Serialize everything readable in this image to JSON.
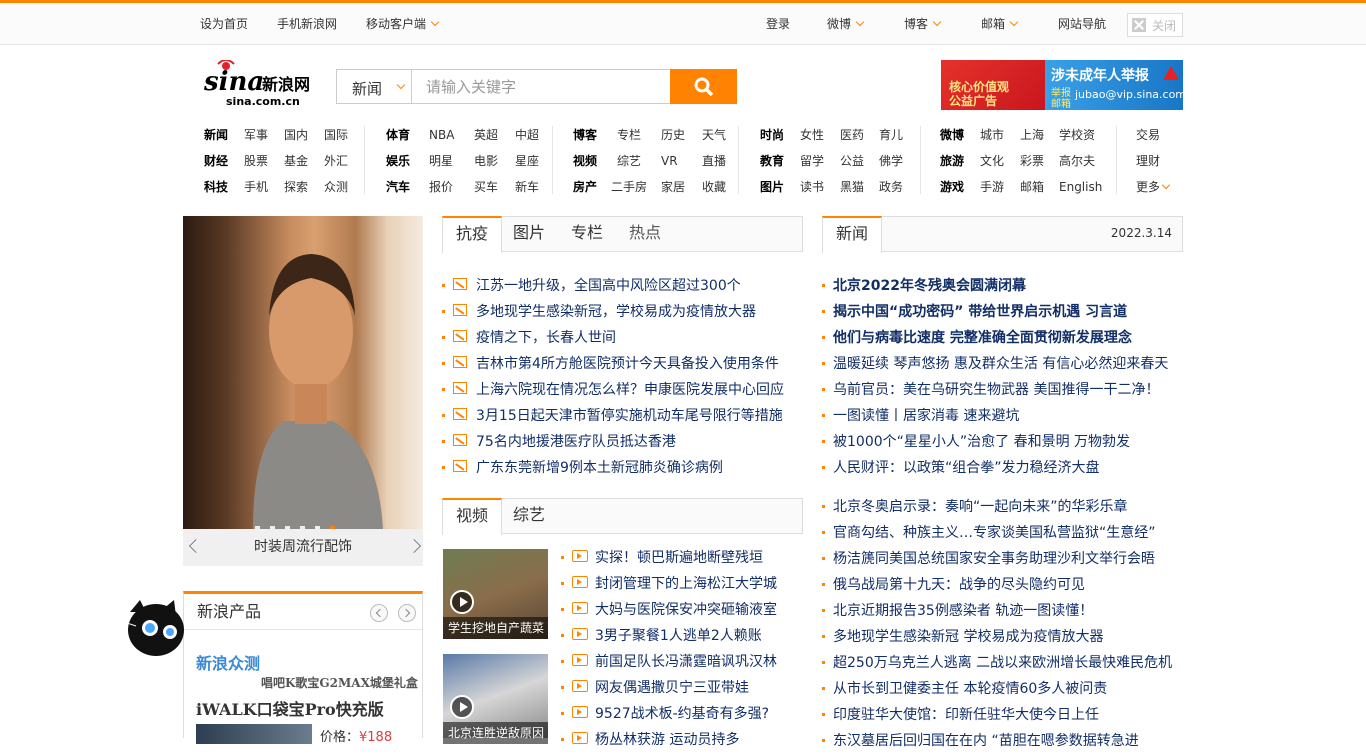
{
  "topbar": {
    "left": [
      "设为首页",
      "手机新浪网",
      "移动客户端"
    ],
    "right": [
      "登录",
      "微博",
      "博客",
      "邮箱",
      "网站导航"
    ],
    "close_label": "关闭"
  },
  "logo": {
    "brand": "sina新浪网",
    "domain": "sina.com.cn"
  },
  "search": {
    "category": "新闻",
    "placeholder": "请输入关键字"
  },
  "ad": {
    "left_text_1": "核心价值观",
    "left_text_2": "公益广告",
    "title": "涉未成年人举报",
    "sub_label": "举报邮箱",
    "email": "jubao@vip.sina.com"
  },
  "nav": {
    "g1": [
      [
        "新闻",
        "军事",
        "国内",
        "国际"
      ],
      [
        "财经",
        "股票",
        "基金",
        "外汇"
      ],
      [
        "科技",
        "手机",
        "探索",
        "众测"
      ]
    ],
    "g2": [
      [
        "体育",
        "NBA",
        "英超",
        "中超"
      ],
      [
        "娱乐",
        "明星",
        "电影",
        "星座"
      ],
      [
        "汽车",
        "报价",
        "买车",
        "新车"
      ]
    ],
    "g3": [
      [
        "博客",
        "专栏",
        "历史",
        "天气"
      ],
      [
        "视频",
        "综艺",
        "VR",
        "直播"
      ],
      [
        "房产",
        "二手房",
        "家居",
        "收藏"
      ]
    ],
    "g4": [
      [
        "时尚",
        "女性",
        "医药",
        "育儿"
      ],
      [
        "教育",
        "留学",
        "公益",
        "佛学"
      ],
      [
        "图片",
        "读书",
        "黑猫",
        "政务"
      ]
    ],
    "g5": [
      [
        "微博",
        "城市",
        "上海",
        "学校资"
      ],
      [
        "旅游",
        "文化",
        "彩票",
        "高尔夫"
      ],
      [
        "游戏",
        "手游",
        "邮箱",
        "English"
      ]
    ],
    "g6": [
      "交易",
      "理财",
      "更多"
    ]
  },
  "focus": {
    "caption": "时装周流行配饰"
  },
  "tabs1": {
    "items": [
      "抗疫",
      "图片",
      "专栏",
      "热点"
    ]
  },
  "list1": [
    "江苏一地升级，全国高中风险区超过300个",
    "多地现学生感染新冠，学校易成为疫情放大器",
    "疫情之下，长春人世间",
    "吉林市第4所方舱医院预计今天具备投入使用条件",
    "上海六院现在情况怎么样？申康医院发展中心回应",
    "3月15日起天津市暂停实施机动车尾号限行等措施",
    "75名内地援港医疗队员抵达香港",
    "广东东莞新增9例本土新冠肺炎确诊病例"
  ],
  "tabs2": {
    "items": [
      "视频",
      "综艺"
    ]
  },
  "thumbs": [
    "学生挖地自产蔬菜",
    "北京连胜逆敌原因"
  ],
  "list2": [
    "实探！顿巴斯遍地断壁残垣",
    "封闭管理下的上海松江大学城",
    "大妈与医院保安冲突砸输液室",
    "3男子聚餐1人逃单2人赖账",
    "前国足队长冯潇霆暗讽巩汉林",
    "网友偶遇撒贝宁三亚带娃",
    "9527战术板-约基奇有多强?",
    "杨丛林获游 运动员持多"
  ],
  "newsbar": {
    "tab": "新闻",
    "date": "2022.3.14"
  },
  "news_bold": [
    "北京2022年冬残奥会圆满闭幕",
    "揭示中国“成功密码” 带给世界启示机遇 习言道",
    "他们与病毒比速度 完整准确全面贯彻新发展理念"
  ],
  "news_a": [
    "温暖延续 琴声悠扬 惠及群众生活 有信心必然迎来春天",
    "乌前官员：美在乌研究生物武器 美国推得一干二净！",
    "一图读懂丨居家消毒 速来避坑",
    "被1000个“星星小人”治愈了 春和景明 万物勃发",
    "人民财评：以政策“组合拳”发力稳经济大盘"
  ],
  "news_b": [
    "北京冬奥启示录：奏响“一起向未来”的华彩乐章",
    "官商勾结、种族主义…专家谈美国私营监狱“生意经”",
    "杨洁篪同美国总统国家安全事务助理沙利文举行会晤",
    "俄乌战局第十九天：战争的尽头隐约可见",
    "北京近期报告35例感染者 轨迹一图读懂！",
    "多地现学生感染新冠 学校易成为疫情放大器",
    "超250万乌克兰人逃离 二战以来欧洲增长最快难民危机",
    "从市长到卫健委主任 本轮疫情60多人被问责",
    "印度驻华大使馆：印新任驻华大使今日上任",
    "东汉墓居后回归国在在内 “苗胆在嗯参数据转急进"
  ],
  "products": {
    "title": "新浪产品",
    "brand": "新浪众测",
    "promo": "唱吧K歌宝G2MAX城堡礼盒",
    "item": "iWALK口袋宝Pro快充版",
    "price_label": "价格：",
    "price": "¥188"
  },
  "colors": {
    "accent": "#ff8400",
    "link": "#122e67",
    "price": "#e4393c"
  }
}
